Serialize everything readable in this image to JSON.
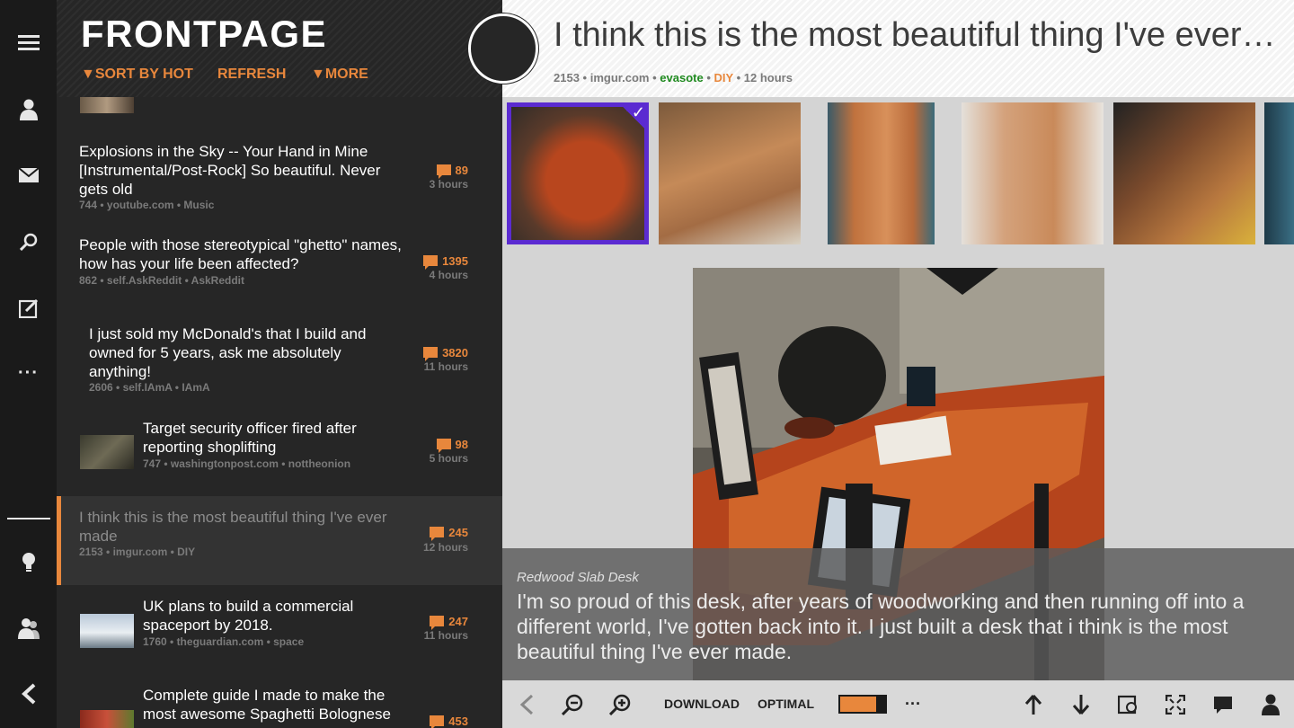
{
  "header": {
    "title": "FRONTPAGE",
    "sort_label": "▼SORT BY HOT",
    "refresh_label": "REFRESH",
    "more_label": "▼MORE"
  },
  "rail": {
    "icons": [
      "menu-icon",
      "profile-icon",
      "mail-icon",
      "search-icon",
      "compose-icon",
      "more-icon",
      "lightbulb-icon",
      "friends-icon",
      "back-icon"
    ],
    "more_label": "···"
  },
  "posts": [
    {
      "title": "Explosions in the Sky -- Your Hand in Mine [Instrumental/Post-Rock] So beautiful. Never gets old",
      "meta": "744 • youtube.com • Music",
      "comments": "89",
      "age": "3 hours"
    },
    {
      "title": "People with those stereotypical \"ghetto\" names, how has your life been affected?",
      "meta": "862 • self.AskReddit • AskReddit",
      "comments": "1395",
      "age": "4 hours"
    },
    {
      "title": "I just sold my McDonald's that I build and owned for 5 years, ask me absolutely anything!",
      "meta": "2606 • self.IAmA • IAmA",
      "comments": "3820",
      "age": "11 hours"
    },
    {
      "title": "Target security officer fired after reporting shoplifting",
      "meta": "747 • washingtonpost.com • nottheonion",
      "comments": "98",
      "age": "5 hours"
    },
    {
      "title": "I think this is the most beautiful thing I've ever made",
      "meta": "2153 • imgur.com • DIY",
      "comments": "245",
      "age": "12 hours"
    },
    {
      "title": "UK plans to build a commercial spaceport by 2018.",
      "meta": "1760 • theguardian.com • space",
      "comments": "247",
      "age": "11 hours"
    },
    {
      "title": "Complete guide I made to make the most awesome Spaghetti Bolognese",
      "meta": "",
      "comments": "453",
      "age": ""
    }
  ],
  "detail": {
    "title": "I think this is the most beautiful thing I've ever…",
    "score": "2153",
    "domain": "imgur.com",
    "user": "evasote",
    "subreddit": "DIY",
    "age": "12 hours",
    "sep": "•"
  },
  "caption": {
    "title": "Redwood Slab Desk",
    "text": "I'm so proud of this desk, after years of woodworking and then running off into a different world, I've gotten back into it. I just built a desk that i think is the most beautiful thing I've ever made."
  },
  "toolbar": {
    "download_label": "DOWNLOAD",
    "quality_label": "OPTIMAL",
    "more_label": "···",
    "accent": "#e8873c"
  },
  "colors": {
    "accent": "#e8873c",
    "selection": "#5b2bd1",
    "user": "#1f8a1f"
  }
}
